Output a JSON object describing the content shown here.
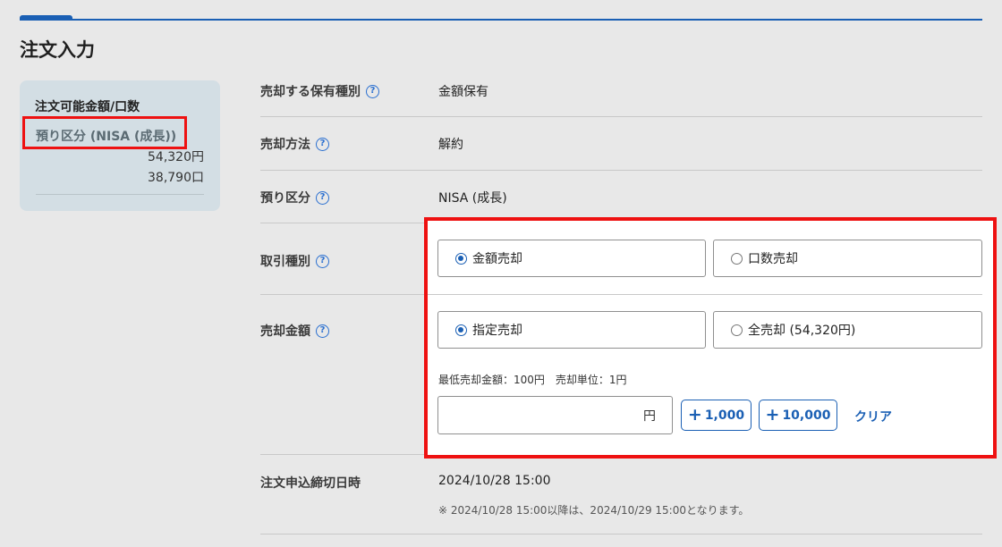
{
  "page": {
    "title": "注文入力"
  },
  "side": {
    "title": "注文可能金額/口数",
    "account": "預り区分 (NISA (成長))",
    "amount": "54,320円",
    "units": "38,790口"
  },
  "rows": {
    "holding_type": {
      "label": "売却する保有種別",
      "value": "金額保有"
    },
    "method": {
      "label": "売却方法",
      "value": "解約"
    },
    "account": {
      "label": "預り区分",
      "value": "NISA (成長)"
    },
    "trade_type": {
      "label": "取引種別",
      "options": [
        "金額売却",
        "口数売却"
      ],
      "selected": "金額売却"
    },
    "sell_amount": {
      "label": "売却金額",
      "options": [
        "指定売却",
        "全売却 (54,320円)"
      ],
      "selected": "指定売却",
      "note": "最低売却金額：100円　売却単位：1円",
      "input_value": "",
      "input_unit": "円",
      "increment_buttons": [
        "1,000",
        "10,000"
      ],
      "clear_label": "クリア"
    },
    "deadline": {
      "label": "注文申込締切日時",
      "value": "2024/10/28 15:00",
      "note": "※ 2024/10/28 15:00以降は、2024/10/29 15:00となります。"
    }
  },
  "icons": {
    "help": "question-circle-icon",
    "plus": "plus-icon"
  },
  "colors": {
    "accent": "#1a5fb4",
    "highlight": "#ee1111"
  }
}
